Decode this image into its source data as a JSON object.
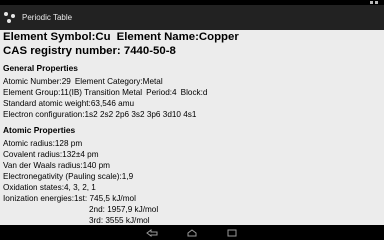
{
  "action_bar": {
    "title": "Periodic Table"
  },
  "heading": {
    "symbol": "Element Symbol:Cu",
    "name": "Element Name:Copper",
    "cas": "CAS registry number: 7440-50-8"
  },
  "general": {
    "title": "General Properties",
    "atomic_number": "Atomic Number:29",
    "category": "Element Category:Metal",
    "group": "Element Group:11(IB) Transition Metal",
    "period": "Period:4",
    "block": "Block:d",
    "weight": "Standard atomic weight:63,546 amu",
    "config": "Electron configuration:1s2 2s2 2p6 3s2 3p6 3d10 4s1"
  },
  "atomic": {
    "title": "Atomic Properties",
    "radius": "Atomic radius:128 pm",
    "covalent": "Covalent radius:132±4 pm",
    "vdw": "Van der Waals radius:140 pm",
    "electroneg": "Electronegativity (Pauling scale):1,9",
    "oxidation": "Oxidation states:4, 3, 2, 1",
    "ionization_1": "Ionization energies:1st: 745,5 kJ/mol",
    "ionization_2": "2nd: 1957,9 kJ/mol",
    "ionization_3": "3rd: 3555 kJ/mol"
  },
  "icons": {
    "app": "atom-icon",
    "back": "back-icon",
    "home": "home-icon",
    "recents": "recents-icon"
  }
}
